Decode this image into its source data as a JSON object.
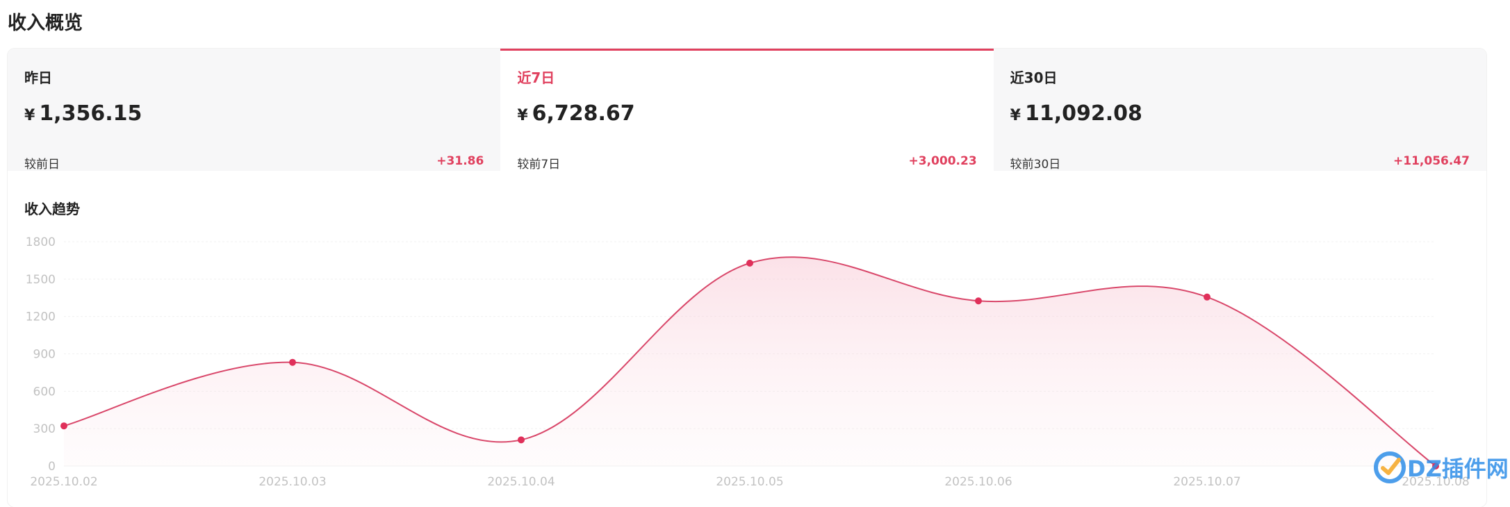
{
  "page": {
    "title": "收入概览"
  },
  "tabs": [
    {
      "label": "昨日",
      "currency": "¥",
      "amount": "1,356.15",
      "compare_label": "较前日",
      "delta": "+31.86",
      "active": false
    },
    {
      "label": "近7日",
      "currency": "¥",
      "amount": "6,728.67",
      "compare_label": "较前7日",
      "delta": "+3,000.23",
      "active": true
    },
    {
      "label": "近30日",
      "currency": "¥",
      "amount": "11,092.08",
      "compare_label": "较前30日",
      "delta": "+11,056.47",
      "active": false
    }
  ],
  "chart_title": "收入趋势",
  "chart_data": {
    "type": "area",
    "title": "收入趋势",
    "x": [
      "2025.10.02",
      "2025.10.03",
      "2025.10.04",
      "2025.10.05",
      "2025.10.06",
      "2025.10.07",
      "2025.10.08"
    ],
    "series": [
      {
        "values": [
          322,
          832,
          210,
          1628,
          1325,
          1356,
          0
        ]
      }
    ],
    "yticks": [
      0,
      300,
      600,
      900,
      1200,
      1500,
      1800
    ],
    "ylim": [
      0,
      1800
    ],
    "xlabel": "",
    "ylabel": "",
    "grid": true,
    "colors": {
      "line": "#d9476a",
      "point": "#e0305a",
      "fill": "#fbe3e9"
    }
  },
  "watermark": {
    "text": "DZ插件网"
  },
  "colors": {
    "accent": "#e0405e"
  }
}
